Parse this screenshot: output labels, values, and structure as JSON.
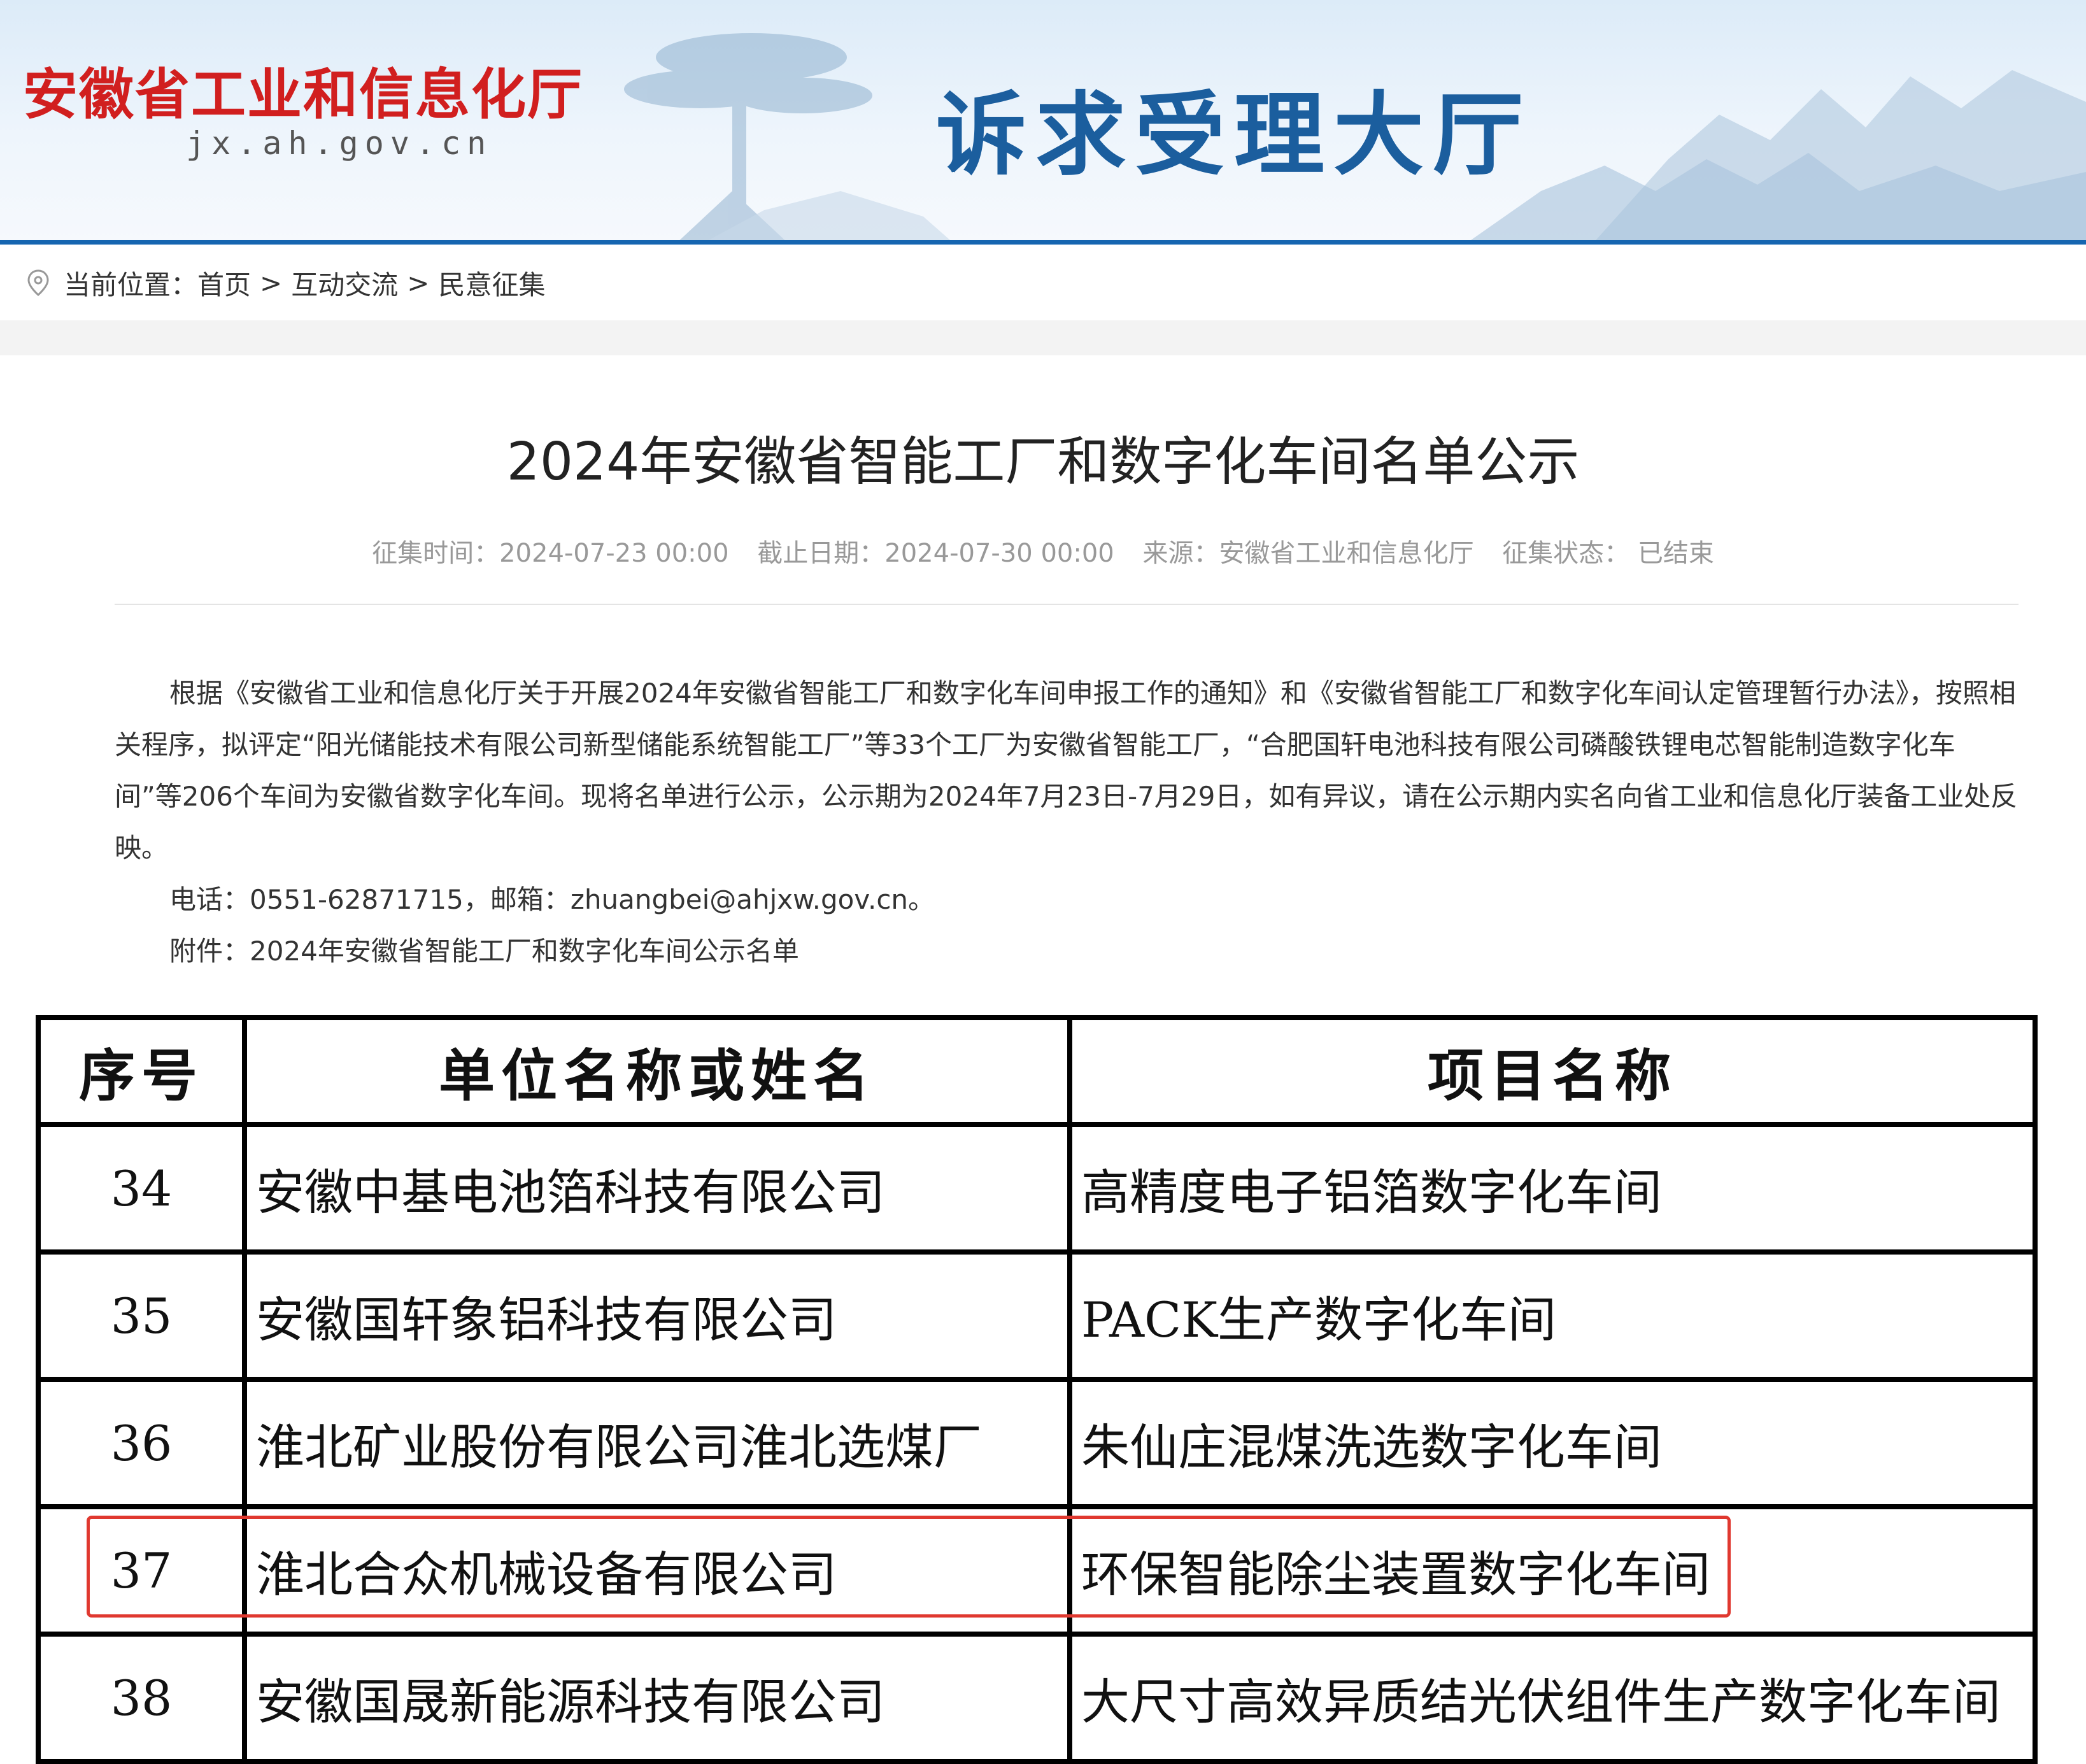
{
  "header": {
    "org_name": "安徽省工业和信息化厅",
    "org_url": "jx.ah.gov.cn",
    "hall_title": "诉求受理大厅"
  },
  "breadcrumb": {
    "prefix": "当前位置：",
    "items": [
      "首页",
      "互动交流",
      "民意征集"
    ],
    "separator": ">"
  },
  "article": {
    "title": "2024年安徽省智能工厂和数字化车间名单公示",
    "meta": {
      "start": "征集时间：2024-07-23 00:00",
      "end": "截止日期：2024-07-30 00:00",
      "source": "来源：安徽省工业和信息化厅",
      "status": "征集状态：  已结束"
    },
    "paragraph": "根据《安徽省工业和信息化厅关于开展2024年安徽省智能工厂和数字化车间申报工作的通知》和《安徽省智能工厂和数字化车间认定管理暂行办法》，按照相关程序，拟评定“阳光储能技术有限公司新型储能系统智能工厂”等33个工厂为安徽省智能工厂，“合肥国轩电池科技有限公司磷酸铁锂电芯智能制造数字化车间”等206个车间为安徽省数字化车间。现将名单进行公示，公示期为2024年7月23日-7月29日，如有异议，请在公示期内实名向省工业和信息化厅装备工业处反映。",
    "contact": "电话：0551-62871715，邮箱：zhuangbei@ahjxw.gov.cn。",
    "attachment_label": "附件：",
    "attachment": "2024年安徽省智能工厂和数字化车间公示名单"
  },
  "table": {
    "headers": [
      "序号",
      "单位名称或姓名",
      "项目名称"
    ],
    "rows": [
      {
        "no": "34",
        "unit": "安徽中基电池箔科技有限公司",
        "project": "高精度电子铝箔数字化车间"
      },
      {
        "no": "35",
        "unit": "安徽国轩象铝科技有限公司",
        "project": "PACK生产数字化车间"
      },
      {
        "no": "36",
        "unit": "淮北矿业股份有限公司淮北选煤厂",
        "project": "朱仙庄混煤洗选数字化车间"
      },
      {
        "no": "37",
        "unit": "淮北合众机械设备有限公司",
        "project": "环保智能除尘装置数字化车间"
      },
      {
        "no": "38",
        "unit": "安徽国晟新能源科技有限公司",
        "project": "大尺寸高效异质结光伏组件生产数字化车间"
      }
    ]
  },
  "colors": {
    "org_red": "#d11f1f",
    "hall_blue": "#1b5e9e",
    "banner_line": "#1565b0",
    "highlight_red": "#e0382f"
  }
}
